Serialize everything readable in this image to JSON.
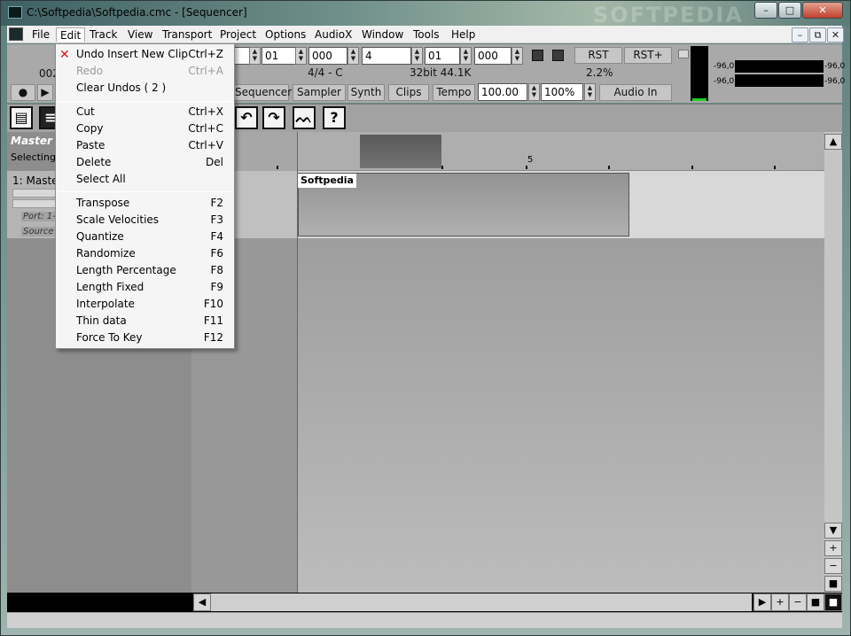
{
  "window": {
    "title": "C:\\Softpedia\\Softpedia.cmc - [Sequencer]",
    "watermark": "SOFTPEDIA",
    "controls": {
      "minimize": "–",
      "maximize": "□",
      "close": "✕"
    }
  },
  "menubar": {
    "items": [
      "File",
      "Edit",
      "Track",
      "View",
      "Transport",
      "Project",
      "Options",
      "AudioX",
      "Window",
      "Tools",
      "Help"
    ],
    "mdi": {
      "minimize": "–",
      "restore": "⧉",
      "close": "✕"
    }
  },
  "transport": {
    "left_number": "002",
    "fields": [
      "01",
      "000",
      "4",
      "01",
      "000"
    ],
    "time_signature": "4/4 - C",
    "format": "32bit 44.1K",
    "cpu": "2.2%",
    "rst": "RST",
    "rst_plus": "RST+",
    "record_symbol": "●",
    "play_symbol": "▶",
    "tabs": [
      "Sequencer",
      "Sampler",
      "Synth",
      "Clips",
      "Tempo"
    ],
    "tempo": "100.00",
    "zoom": "100%",
    "audio_in": "Audio In"
  },
  "meters": {
    "left_top": "-96,0",
    "right_top": "-96,0",
    "left_bottom": "-96,0",
    "right_bottom": "-96,0"
  },
  "toolbar": {
    "undo_icon": "↶",
    "redo_icon": "↷",
    "wave_icon": "ᨓ",
    "help_icon": "?"
  },
  "left_panel": {
    "master": "Master",
    "selecting": "Selecting/",
    "track_name": "1: Maste",
    "port": "Port: 1-",
    "source": "Source"
  },
  "timeline": {
    "marker_5": "5"
  },
  "clip": {
    "name": "Softpedia"
  },
  "scroll": {
    "up": "▲",
    "down": "▼",
    "plus": "+",
    "minus": "−",
    "stop": "■",
    "left": "◀",
    "right": "▶"
  },
  "edit_menu": {
    "items": [
      {
        "label": "Undo Insert New Clip",
        "shortcut": "Ctrl+Z",
        "enabled": true
      },
      {
        "label": "Redo",
        "shortcut": "Ctrl+A",
        "enabled": false
      },
      {
        "label": "Clear Undos ( 2 )",
        "shortcut": "",
        "enabled": true
      },
      {
        "label": "Cut",
        "shortcut": "Ctrl+X",
        "enabled": true
      },
      {
        "label": "Copy",
        "shortcut": "Ctrl+C",
        "enabled": true
      },
      {
        "label": "Paste",
        "shortcut": "Ctrl+V",
        "enabled": true
      },
      {
        "label": "Delete",
        "shortcut": "Del",
        "enabled": true
      },
      {
        "label": "Select All",
        "shortcut": "",
        "enabled": true
      },
      {
        "label": "Transpose",
        "shortcut": "F2",
        "enabled": true
      },
      {
        "label": "Scale Velocities",
        "shortcut": "F3",
        "enabled": true
      },
      {
        "label": "Quantize",
        "shortcut": "F4",
        "enabled": true
      },
      {
        "label": "Randomize",
        "shortcut": "F6",
        "enabled": true
      },
      {
        "label": "Length Percentage",
        "shortcut": "F8",
        "enabled": true
      },
      {
        "label": "Length Fixed",
        "shortcut": "F9",
        "enabled": true
      },
      {
        "label": "Interpolate",
        "shortcut": "F10",
        "enabled": true
      },
      {
        "label": "Thin data",
        "shortcut": "F11",
        "enabled": true
      },
      {
        "label": "Force To Key",
        "shortcut": "F12",
        "enabled": true
      }
    ]
  },
  "colors": {
    "accent_red": "#dd1111",
    "meter_green": "#22cc22"
  }
}
